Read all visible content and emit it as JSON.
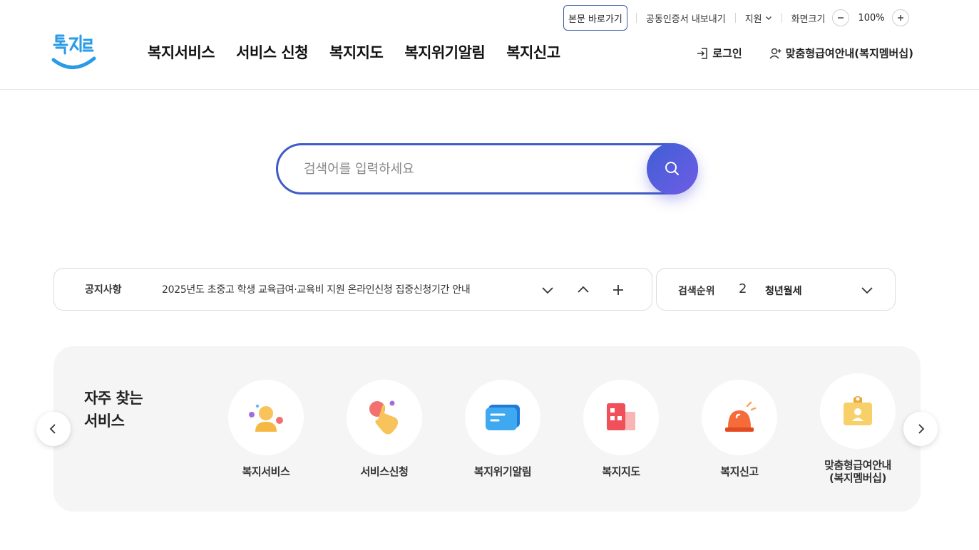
{
  "util": {
    "skip_to_content": "본문 바로가기",
    "cert_export": "공동인증서 내보내기",
    "support": "지원",
    "screen_size_label": "화면크기",
    "zoom_value": "100%"
  },
  "header": {
    "logo_text": "복지로",
    "nav": [
      "복지서비스",
      "서비스 신청",
      "복지지도",
      "복지위기알림",
      "복지신고"
    ],
    "login": "로그인",
    "membership": "맞춤형급여안내(복지멤버십)"
  },
  "search": {
    "placeholder": "검색어를 입력하세요"
  },
  "notice": {
    "label": "공지사항",
    "text": "2025년도 초중고 학생 교육급여·교육비 지원 온라인신청 집중신청기간 안내"
  },
  "rank": {
    "label": "검색순위",
    "number": "2",
    "term": "청년월세"
  },
  "frequent": {
    "title_line1": "자주 찾는",
    "title_line2": "서비스",
    "items": [
      {
        "label": "복지서비스",
        "icon": "person-icon"
      },
      {
        "label": "서비스신청",
        "icon": "hand-click-icon"
      },
      {
        "label": "복지위기알림",
        "icon": "message-icon"
      },
      {
        "label": "복지지도",
        "icon": "map-building-icon"
      },
      {
        "label": "복지신고",
        "icon": "siren-icon"
      },
      {
        "label": "맞춤형급여안내\n(복지멤버십)",
        "icon": "membership-card-icon"
      }
    ]
  },
  "colors": {
    "brand_blue": "#3f5bc7",
    "search_gradient_start": "#3f5fd4",
    "search_gradient_end": "#6f5ce6",
    "logo_blue": "#2a9be6",
    "panel_bg": "#f5f5f5"
  }
}
